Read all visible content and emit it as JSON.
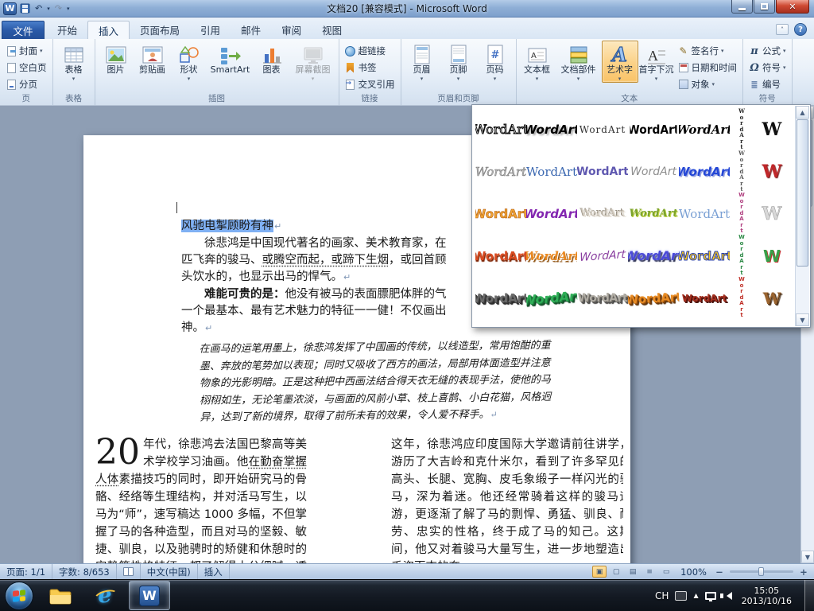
{
  "titlebar": {
    "title": "文档20 [兼容模式]  -  Microsoft Word"
  },
  "ribbon": {
    "file_tab": "文件",
    "tabs": [
      "开始",
      "插入",
      "页面布局",
      "引用",
      "邮件",
      "审阅",
      "视图"
    ],
    "active_tab": "插入",
    "groups": {
      "page": {
        "label": "页",
        "items": [
          "封面",
          "空白页",
          "分页"
        ]
      },
      "table": {
        "label": "表格",
        "items": [
          "表格"
        ]
      },
      "illustrations": {
        "label": "插图",
        "items": [
          "图片",
          "剪贴画",
          "形状",
          "SmartArt",
          "图表",
          "屏幕截图"
        ]
      },
      "links": {
        "label": "链接",
        "items": [
          "超链接",
          "书签",
          "交叉引用"
        ]
      },
      "header_footer": {
        "label": "页眉和页脚",
        "items": [
          "页眉",
          "页脚",
          "页码"
        ]
      },
      "text": {
        "label": "文本",
        "items": [
          "文本框",
          "文档部件",
          "艺术字",
          "首字下沉",
          "签名行",
          "日期和时间",
          "对象"
        ]
      },
      "symbols": {
        "label": "符号",
        "items": [
          "公式",
          "符号",
          "编号"
        ]
      }
    }
  },
  "wordart": {
    "rows": [
      [
        {
          "t": "WordArt",
          "cls": "w11"
        },
        {
          "t": "WordArt",
          "cls": "w12"
        },
        {
          "t": "WordArt",
          "cls": "w13"
        },
        {
          "t": "WordArt",
          "cls": "w14"
        },
        {
          "t": "WordArt",
          "cls": "w15"
        },
        {
          "t": "WordArt",
          "cls": "w16",
          "v": true
        },
        {
          "t": "W",
          "cls": "w17"
        }
      ],
      [
        {
          "t": "WordArt",
          "cls": "w21"
        },
        {
          "t": "WordArt",
          "cls": "w22"
        },
        {
          "t": "WordArt",
          "cls": "w23"
        },
        {
          "t": "WordArt",
          "cls": "w24"
        },
        {
          "t": "WordArt",
          "cls": "w25"
        },
        {
          "t": "WordArt",
          "cls": "w26",
          "v": true
        },
        {
          "t": "W",
          "cls": "w27"
        }
      ],
      [
        {
          "t": "WordArt",
          "cls": "w31"
        },
        {
          "t": "WordArt",
          "cls": "w32"
        },
        {
          "t": "WordArt",
          "cls": "w33"
        },
        {
          "t": "WordArt",
          "cls": "w34"
        },
        {
          "t": "WordArt",
          "cls": "w35"
        },
        {
          "t": "WordArt",
          "cls": "w36",
          "v": true
        },
        {
          "t": "W",
          "cls": "w37"
        }
      ],
      [
        {
          "t": "WordArt",
          "cls": "w41"
        },
        {
          "t": "WordArt",
          "cls": "w42"
        },
        {
          "t": "WordArt",
          "cls": "w43"
        },
        {
          "t": "WordArt",
          "cls": "w44"
        },
        {
          "t": "WordArt",
          "cls": "w45"
        },
        {
          "t": "WordArt",
          "cls": "w46",
          "v": true
        },
        {
          "t": "W",
          "cls": "w47"
        }
      ],
      [
        {
          "t": "WordArt",
          "cls": "w51"
        },
        {
          "t": "WordArt",
          "cls": "w52"
        },
        {
          "t": "WordArt",
          "cls": "w53"
        },
        {
          "t": "WordArt",
          "cls": "w54"
        },
        {
          "t": "WordArt",
          "cls": "w55"
        },
        {
          "t": "WordArt",
          "cls": "w56",
          "v": true
        },
        {
          "t": "W",
          "cls": "w57"
        }
      ]
    ]
  },
  "document": {
    "title": "风驰电掣顾盼有神",
    "para_mark": "↵",
    "p1": {
      "l1": "徐悲鸿是中国现代著名的画家、美术教育家，在",
      "l2a": "匹飞奔的骏马、",
      "l2b": "或腾空而起，或蹄下生烟",
      "l2c": "，或回首顾",
      "l3": "头饮水的，也显示出马的悍气。"
    },
    "p2": {
      "lead": "难能可贵的是：",
      "l1": "他没有被马的表面膘肥体胖的气",
      "l2": "一个最基本、最有艺术魅力的特征一一健！不仅画出",
      "l3": "神。"
    },
    "slant": {
      "l1": "在画马的运笔用墨上，徐悲鸿发挥了中国画的传统，以线造型，常用饱酣的重",
      "l2": "墨、奔放的笔势加以表现；同时又吸收了西方的画法，局部用体面造型并注意",
      "l3": "物象的光影明暗。正是这种把中西画法结合得天衣无缝的表现手法，使他的马",
      "l4": "栩栩如生，无论笔墨浓淡，与画面的风前小草、枝上喜鹊、小白花猫，风格迥",
      "l5": "异，达到了新的境界，取得了前所未有的效果，令人爱不释手。"
    },
    "colL": {
      "dropcap": "20",
      "a": "年代，徐悲鸿去法国巴黎高等美术学校学习油画。他",
      "b": "在勤奋掌握人体",
      "c": "素描技巧的同时，即开始研究马的骨骼、经络等生理结构，并对活马写生，以马为“师”，速写稿达 1000 多幅，不但掌握了马的各种造型，而且对马的坚毅、敏捷、驯良，以及驰骋时的矫健和休憩时的安静等性格特征，都了解得十分细腻、透彻"
    },
    "colR": "这年，徐悲鸿应印度国际大学邀请前往讲学，游历了大吉岭和克什米尔，看到了许多罕见的高头、长腿、宽胸、皮毛象缎子一样闪光的骏马，深为着迷。他还经常骑着这样的骏马远游，更逐渐了解了马的剽悍、勇猛、驯良、耐劳、忠实的性格，终于成了马的知己。这期间，他又对着骏马大量写生，进一步地塑造出千姿百态的奔"
  },
  "statusbar": {
    "page": "页面: 1/1",
    "words": "字数: 8/653",
    "lang": "中文(中国)",
    "mode": "插入",
    "zoom": "100%"
  },
  "taskbar": {
    "lang": "CH",
    "time": "15:05",
    "date": "2013/10/16"
  },
  "colors": {
    "accent_blue": "#2b579a",
    "selection": "#7fb0f3",
    "active_button_orange": "#fbd18b",
    "close_red": "#cf4a33",
    "doc_background": "#8e9eb4"
  }
}
